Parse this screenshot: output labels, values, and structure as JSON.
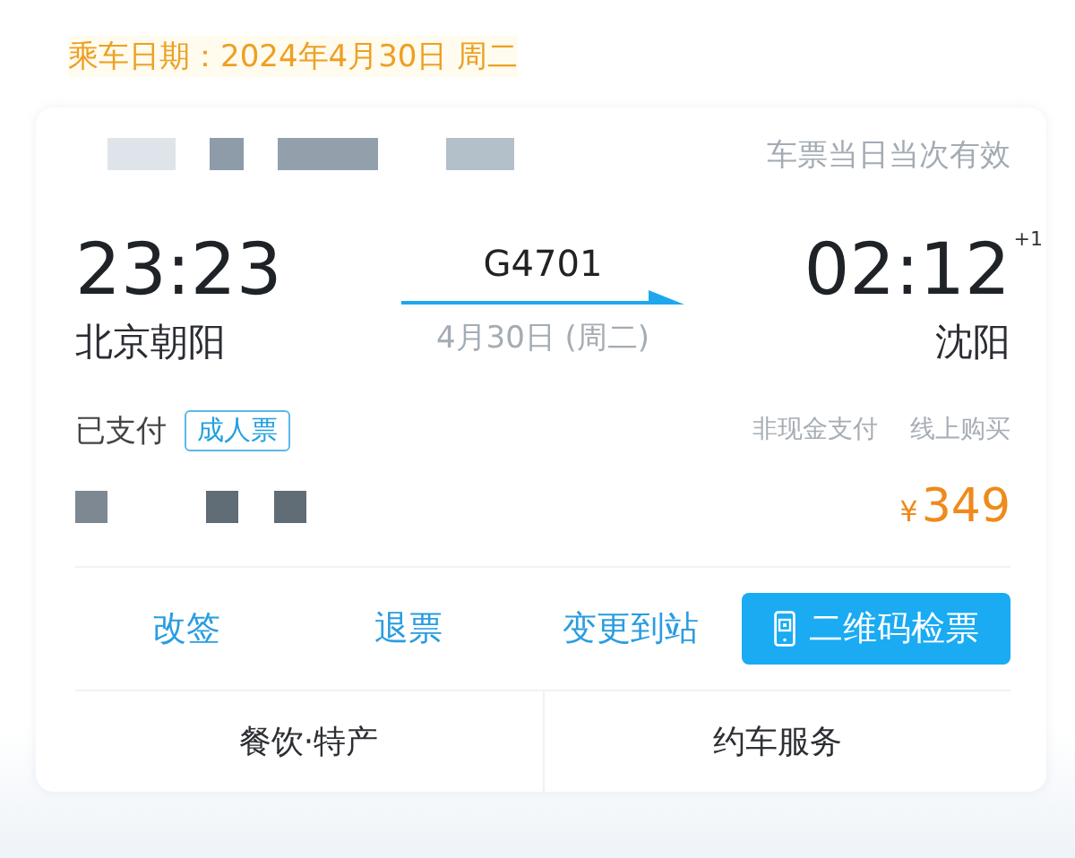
{
  "date_header": "乘车日期：2024年4月30日 周二",
  "ticket": {
    "validity_note": "车票当日当次有效",
    "departure": {
      "time": "23:23",
      "station": "北京朝阳"
    },
    "train_number": "G4701",
    "travel_date": "4月30日 (周二)",
    "arrival": {
      "time": "02:12",
      "day_offset": "+1",
      "station": "沈阳"
    },
    "payment_status": "已支付",
    "ticket_type": "成人票",
    "payment_method": "非现金支付",
    "purchase_channel": "线上购买",
    "price": {
      "currency": "¥",
      "amount": "349"
    }
  },
  "actions": [
    {
      "label": "改签",
      "kind": "link"
    },
    {
      "label": "退票",
      "kind": "link"
    },
    {
      "label": "变更到站",
      "kind": "link"
    },
    {
      "label": "二维码检票",
      "kind": "primary"
    }
  ],
  "services": [
    "餐饮·特产",
    "约车服务"
  ]
}
